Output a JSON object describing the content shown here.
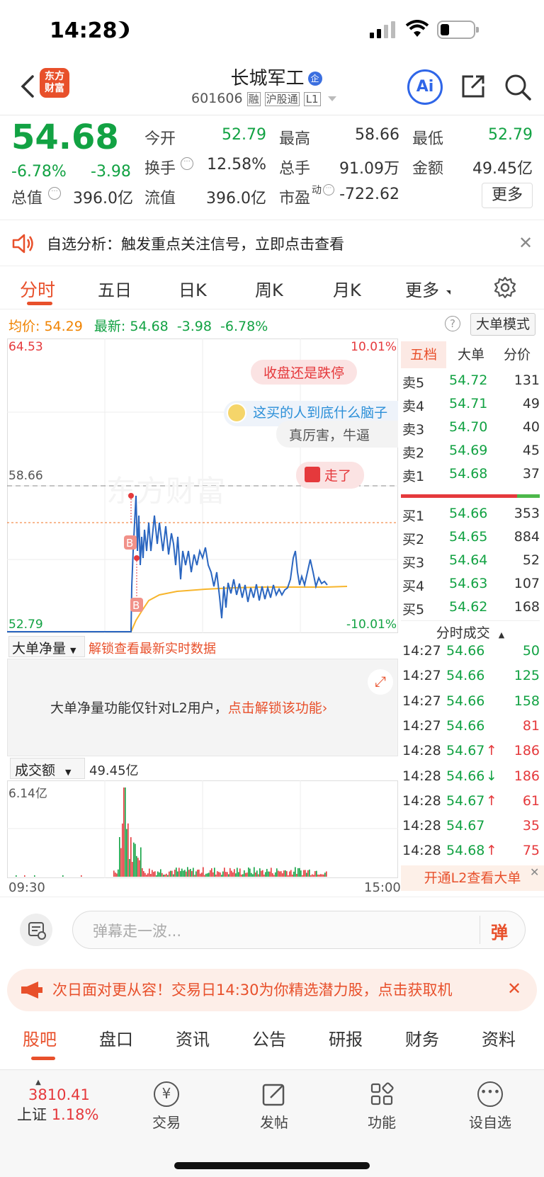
{
  "status": {
    "time": "14:28"
  },
  "header": {
    "title": "长城军工",
    "badge": "企",
    "code": "601606",
    "tag_rong": "融",
    "tag_hgt": "沪股通",
    "tag_l1": "L1",
    "logo_line1": "东方",
    "logo_line2": "财富",
    "ai": "Ai"
  },
  "quote": {
    "price": "54.68",
    "change_pct": "-6.78%",
    "change": "-3.98",
    "open_label": "今开",
    "open": "52.79",
    "high_label": "最高",
    "high": "58.66",
    "low_label": "最低",
    "low": "52.79",
    "turnover_label": "换手",
    "turnover": "12.58%",
    "volume_label": "总手",
    "volume": "91.09万",
    "amount_label": "金额",
    "amount": "49.45亿",
    "mktcap_label": "总值",
    "mktcap": "396.0亿",
    "float_label": "流值",
    "float": "396.0亿",
    "pe_label": "市盈",
    "pe_sup": "动",
    "pe": "-722.62",
    "more": "更多"
  },
  "alert": {
    "text": "自选分析：触发重点关注信号，立即点击查看"
  },
  "chart_tabs": [
    "分时",
    "五日",
    "日K",
    "周K",
    "月K",
    "更多"
  ],
  "info_line": {
    "avg_label": "均价:",
    "avg": "54.29",
    "latest_label": "最新:",
    "latest": "54.68",
    "change": "-3.98",
    "pct": "-6.78%",
    "mode": "大单模式"
  },
  "chart_labels": {
    "top": "64.53",
    "top_pct": "10.01%",
    "mid": "58.66",
    "bottom": "52.79",
    "bottom_pct": "-10.01%",
    "b1": "B",
    "b2": "B"
  },
  "danmu": [
    {
      "text": "收盘还是跌停"
    },
    {
      "text": "这买的人到底什么脑子"
    },
    {
      "text": "真厉害，牛逼"
    },
    {
      "text": "走了"
    }
  ],
  "watermark": "东方财富",
  "orderbook": {
    "tabs": [
      "五档",
      "大单",
      "分价"
    ],
    "asks": [
      {
        "label": "卖5",
        "price": "54.72",
        "vol": "131"
      },
      {
        "label": "卖4",
        "price": "54.71",
        "vol": "49"
      },
      {
        "label": "卖3",
        "price": "54.70",
        "vol": "40"
      },
      {
        "label": "卖2",
        "price": "54.69",
        "vol": "45"
      },
      {
        "label": "卖1",
        "price": "54.68",
        "vol": "37"
      }
    ],
    "bids": [
      {
        "label": "买1",
        "price": "54.66",
        "vol": "353"
      },
      {
        "label": "买2",
        "price": "54.65",
        "vol": "884"
      },
      {
        "label": "买3",
        "price": "54.64",
        "vol": "52"
      },
      {
        "label": "买4",
        "price": "54.63",
        "vol": "107"
      },
      {
        "label": "买5",
        "price": "54.62",
        "vol": "168"
      }
    ],
    "trades_title": "分时成交",
    "trades": [
      {
        "time": "14:27",
        "price": "54.66",
        "arrow": "",
        "vol": "50",
        "color": "green"
      },
      {
        "time": "14:27",
        "price": "54.66",
        "arrow": "",
        "vol": "125",
        "color": "green"
      },
      {
        "time": "14:27",
        "price": "54.66",
        "arrow": "",
        "vol": "158",
        "color": "green"
      },
      {
        "time": "14:27",
        "price": "54.66",
        "arrow": "",
        "vol": "81",
        "color": "red"
      },
      {
        "time": "14:28",
        "price": "54.67",
        "arrow": "↑",
        "vol": "186",
        "color": "red"
      },
      {
        "time": "14:28",
        "price": "54.66",
        "arrow": "↓",
        "vol": "186",
        "color": "red"
      },
      {
        "time": "14:28",
        "price": "54.67",
        "arrow": "↑",
        "vol": "61",
        "color": "red"
      },
      {
        "time": "14:28",
        "price": "54.67",
        "arrow": "",
        "vol": "35",
        "color": "red"
      },
      {
        "time": "14:28",
        "price": "54.68",
        "arrow": "↑",
        "vol": "75",
        "color": "red"
      }
    ],
    "l2_btn": "开通L2查看大单"
  },
  "bignet": {
    "select": "大单净量",
    "unlock_hint": "解锁查看最新实时数据",
    "msg": "大单净量功能仅针对L2用户，",
    "msg_link": "点击解锁该功能"
  },
  "amount": {
    "select": "成交额",
    "value": "49.45亿",
    "max": "6.14亿",
    "t_start": "09:30",
    "t_end": "15:00"
  },
  "danmu_input": {
    "placeholder": "弹幕走一波...",
    "btn": "弹"
  },
  "promo": {
    "text": "次日面对更从容！交易日14:30为你精选潜力股，点击获取机"
  },
  "section_tabs": [
    "股吧",
    "盘口",
    "资讯",
    "公告",
    "研报",
    "财务",
    "资料"
  ],
  "bottom": {
    "index_value": "3810.41",
    "index_name": "上证",
    "index_pct": "1.18%",
    "trade": "交易",
    "post": "发帖",
    "func": "功能",
    "watch": "设自选"
  }
}
